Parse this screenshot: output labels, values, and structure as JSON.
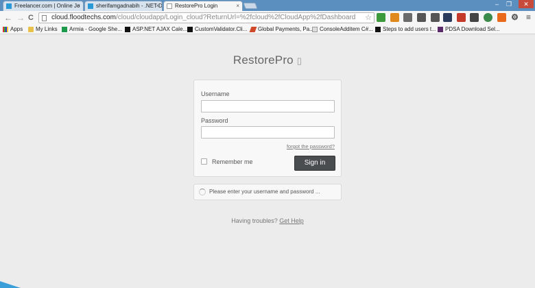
{
  "browser": {
    "tabs": [
      {
        "title": "Freelancer.com | Online Jo",
        "close": "×",
        "active": false
      },
      {
        "title": "sherifamgadnabih - .NET D",
        "close": "×",
        "active": false
      },
      {
        "title": "RestorePro Login",
        "close": "×",
        "active": true
      }
    ],
    "window_controls": {
      "minimize": "–",
      "restore": "❐",
      "close": "✕"
    },
    "nav": {
      "back": "←",
      "forward": "→",
      "reload": "C"
    },
    "url": {
      "host": "cloud.floodtechs.com",
      "path": "/cloud/cloudapp/Login_cloud?ReturnUrl=%2fcloud%2fCloudApp%2fDashboard"
    },
    "star": "☆",
    "menu": "≡",
    "bookmarks": [
      {
        "label": "Apps",
        "icon": "apps-grid-icon"
      },
      {
        "label": "My Links",
        "icon": "folder-icon"
      },
      {
        "label": "Armia - Google She...",
        "icon": "sheets-icon"
      },
      {
        "label": "ASP.NET AJAX Cale...",
        "icon": "aspnet-icon"
      },
      {
        "label": "CustomValidator.Cli...",
        "icon": "m-icon"
      },
      {
        "label": "Global Payments, Pa...",
        "icon": "globalpay-icon"
      },
      {
        "label": "ConsoleAdditem C#...",
        "icon": "console-icon"
      },
      {
        "label": "Steps to add users t...",
        "icon": "m-icon"
      },
      {
        "label": "PDSA Download Sel...",
        "icon": "pdsa-icon"
      }
    ]
  },
  "page": {
    "brand": "RestorePro",
    "brand_glyph": "▯",
    "login": {
      "username_label": "Username",
      "username_value": "",
      "password_label": "Password",
      "password_value": "",
      "forgot_link": "forgot the password?",
      "remember_label": "Remember me",
      "signin_button": "Sign in"
    },
    "status_message": "Please enter your username and password ...",
    "trouble_text": "Having troubles?",
    "help_link": "Get Help"
  }
}
